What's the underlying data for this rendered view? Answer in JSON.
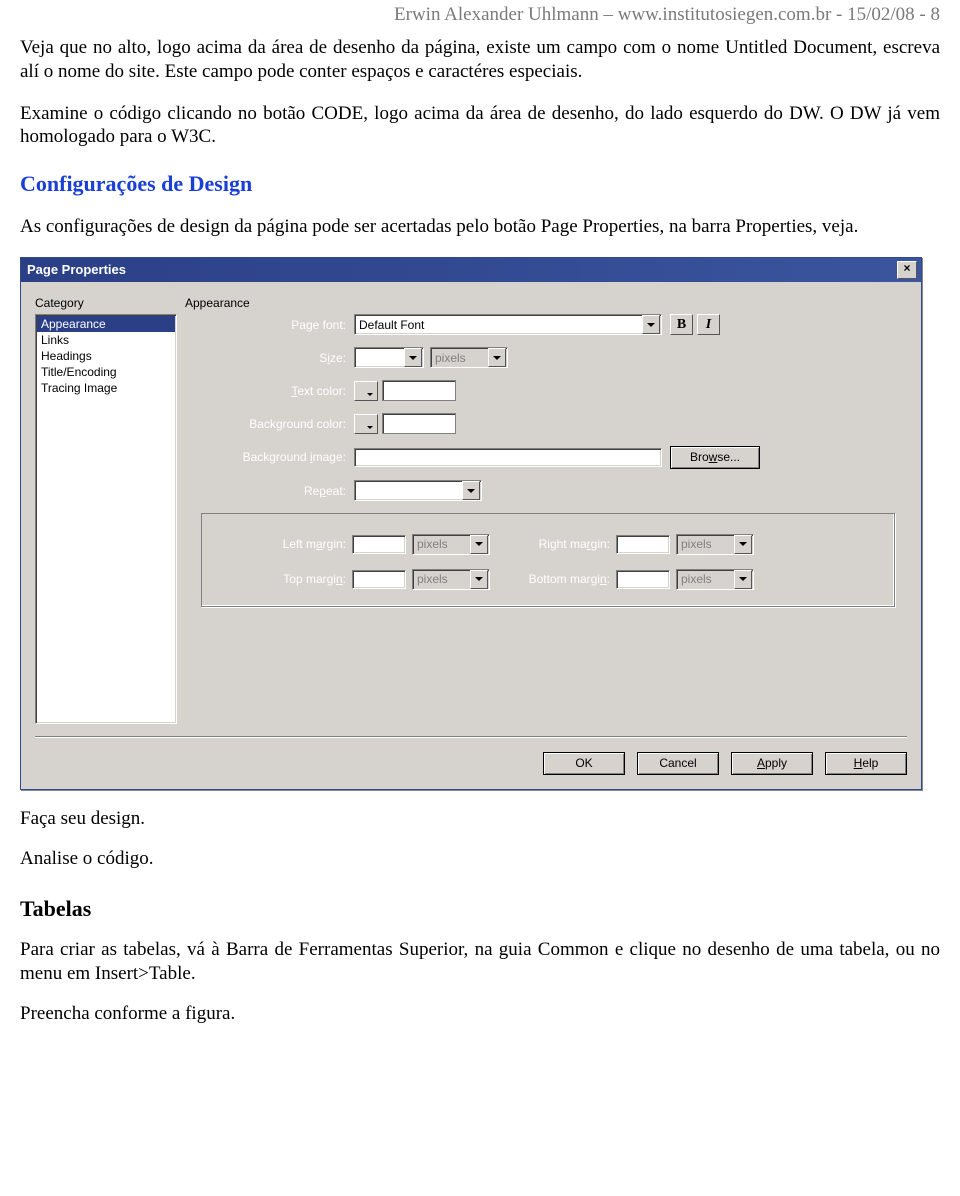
{
  "header": "Erwin Alexander Uhlmann – www.institutosiegen.com.br - 15/02/08 - 8",
  "para1": "Veja que no alto, logo acima da área de desenho da página, existe um campo com o nome Untitled Document, escreva alí o nome do site. Este campo pode conter espaços e caractéres especiais.",
  "para2": "Examine o código clicando no botão CODE, logo acima da área de desenho, do lado esquerdo do DW. O DW já vem homologado para o W3C.",
  "heading1": "Configurações de Design",
  "para3": "As configurações de design da página pode ser acertadas pelo botão Page Properties, na barra Properties, veja.",
  "line_design": "Faça seu design.",
  "line_analyze": "Analise o código.",
  "heading2": "Tabelas",
  "para4": "Para criar as tabelas, vá à Barra de Ferramentas Superior, na guia Common e clique no desenho de uma tabela, ou no menu em Insert>Table.",
  "line_fill": "Preencha conforme a figura.",
  "dialog": {
    "title": "Page Properties",
    "close": "×",
    "category_label": "Category",
    "appearance_label": "Appearance",
    "categories": [
      "Appearance",
      "Links",
      "Headings",
      "Title/Encoding",
      "Tracing Image"
    ],
    "fields": {
      "page_font_label": "Page font:",
      "page_font_value": "Default Font",
      "size_pre": "S",
      "size_ul": "i",
      "size_post": "ze:",
      "text_color_pre": "",
      "text_color_ul": "T",
      "text_color_post": "ext color:",
      "bg_color_pre": "Back",
      "bg_color_ul": "g",
      "bg_color_post": "round color:",
      "bg_image_pre": "Background ",
      "bg_image_ul": "i",
      "bg_image_post": "mage:",
      "repeat_pre": "Re",
      "repeat_ul": "p",
      "repeat_post": "eat:",
      "left_pre": "Left m",
      "left_ul": "a",
      "left_post": "rgin:",
      "right_pre": "Right ma",
      "right_ul": "r",
      "right_post": "gin:",
      "top_pre": "Top margi",
      "top_ul": "n",
      "top_post": ":",
      "bottom_pre": "Bottom margi",
      "bottom_ul": "n",
      "bottom_post": ":",
      "pixels": "pixels",
      "browse_pre": "Bro",
      "browse_ul": "w",
      "browse_post": "se...",
      "bold": "B",
      "italic": "I"
    },
    "buttons": {
      "ok": "OK",
      "cancel": "Cancel",
      "apply_ul": "A",
      "apply_post": "pply",
      "help_ul": "H",
      "help_post": "elp"
    }
  }
}
